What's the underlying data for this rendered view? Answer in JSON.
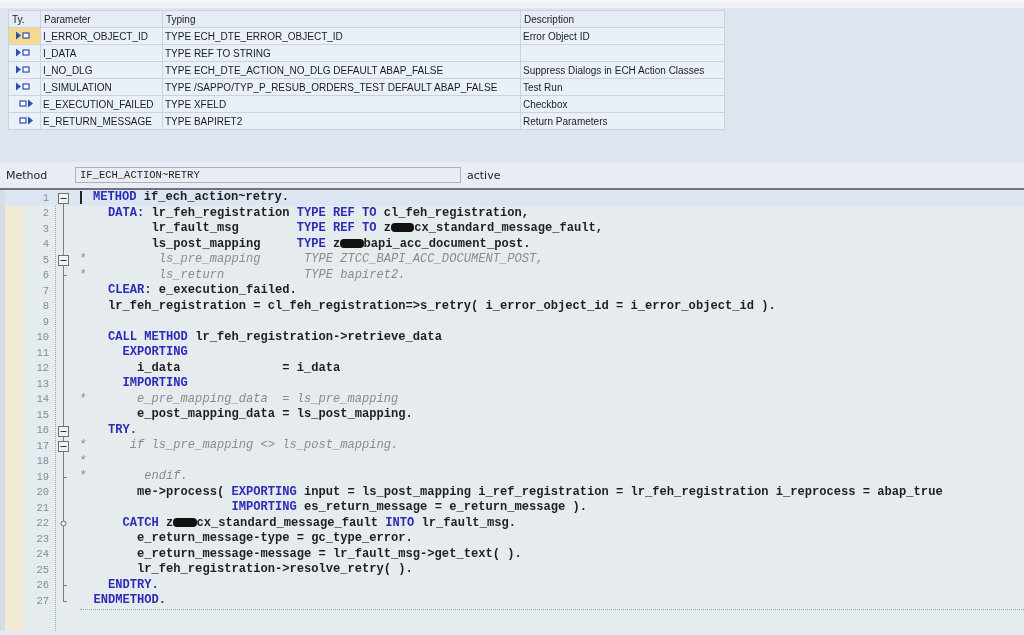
{
  "parameters": {
    "columns": [
      "Ty.",
      "Parameter",
      "Typing",
      "Description"
    ],
    "rows": [
      {
        "kind": "importing",
        "selected": true,
        "name": "I_ERROR_OBJECT_ID",
        "typing": "TYPE ECH_DTE_ERROR_OBJECT_ID",
        "description": "Error Object ID"
      },
      {
        "kind": "importing",
        "selected": false,
        "name": "I_DATA",
        "typing": "TYPE REF TO STRING"
      },
      {
        "kind": "importing",
        "selected": false,
        "name": "I_NO_DLG",
        "typing": "TYPE ECH_DTE_ACTION_NO_DLG  DEFAULT ABAP_FALSE",
        "description": "Suppress Dialogs in ECH Action Classes"
      },
      {
        "kind": "importing",
        "selected": false,
        "name": "I_SIMULATION",
        "typing": "TYPE /SAPPO/TYP_P_RESUB_ORDERS_TEST  DEFAULT ABAP_FALSE",
        "description": "Test Run"
      },
      {
        "kind": "exporting",
        "selected": false,
        "name": "E_EXECUTION_FAILED",
        "typing": "TYPE XFELD",
        "description": "Checkbox"
      },
      {
        "kind": "exporting",
        "selected": false,
        "name": "E_RETURN_MESSAGE",
        "typing": "TYPE BAPIRET2",
        "description": "Return Parameters"
      }
    ]
  },
  "method": {
    "label": "Method",
    "value": "IF_ECH_ACTION~RETRY",
    "status": "active"
  },
  "editor": {
    "lines": [
      {
        "number": "1",
        "kind": "collapse",
        "selected": true,
        "tokens": [
          {
            "kind": "keyword",
            "text": "METHOD"
          },
          {
            "kind": "plain",
            "text": " if_ech_action~retry."
          }
        ]
      },
      {
        "number": "2",
        "kind": "line",
        "selected": false,
        "tokens": [
          {
            "kind": "keyword",
            "text": "    DATA:"
          },
          {
            "kind": "plain",
            "text": " lr_feh_registration "
          },
          {
            "kind": "keyword",
            "text": "TYPE REF TO"
          },
          {
            "kind": "plain",
            "text": " cl_feh_registration,"
          }
        ]
      },
      {
        "number": "3",
        "kind": "line",
        "selected": false,
        "tokens": [
          {
            "kind": "plain",
            "text": "          lr_fault_msg        "
          },
          {
            "kind": "keyword",
            "text": "TYPE REF TO"
          },
          {
            "kind": "plain",
            "text": " z"
          },
          {
            "kind": "redacted"
          },
          {
            "kind": "plain",
            "text": "cx_standard_message_fault,"
          }
        ]
      },
      {
        "number": "4",
        "kind": "line",
        "selected": false,
        "tokens": [
          {
            "kind": "plain",
            "text": "          ls_post_mapping     "
          },
          {
            "kind": "keyword",
            "text": "TYPE"
          },
          {
            "kind": "plain",
            "text": " z"
          },
          {
            "kind": "redacted"
          },
          {
            "kind": "plain",
            "text": "bapi_acc_document_post."
          }
        ]
      },
      {
        "number": "5",
        "kind": "collapse",
        "selected": false,
        "tokens": [
          {
            "kind": "comment",
            "text": "*          ls_pre_mapping      TYPE ZTCC_BAPI_ACC_DOCUMENT_POST,"
          }
        ]
      },
      {
        "number": "6",
        "kind": "end",
        "selected": false,
        "tokens": [
          {
            "kind": "comment",
            "text": "*          ls_return           TYPE bapiret2."
          }
        ]
      },
      {
        "number": "7",
        "kind": "line",
        "selected": false,
        "tokens": [
          {
            "kind": "keyword",
            "text": "    CLEAR:"
          },
          {
            "kind": "plain",
            "text": " e_execution_failed."
          }
        ]
      },
      {
        "number": "8",
        "kind": "line",
        "selected": false,
        "tokens": [
          {
            "kind": "plain",
            "text": "    lr_feh_registration = cl_feh_registration=>s_retry( i_error_object_id = i_error_object_id )."
          }
        ]
      },
      {
        "number": "9",
        "kind": "line",
        "selected": false
      },
      {
        "number": "10",
        "kind": "line",
        "selected": false,
        "tokens": [
          {
            "kind": "keyword",
            "text": "    CALL METHOD"
          },
          {
            "kind": "plain",
            "text": " lr_feh_registration->retrieve_data"
          }
        ]
      },
      {
        "number": "11",
        "kind": "line",
        "selected": false,
        "tokens": [
          {
            "kind": "keyword",
            "text": "      EXPORTING"
          }
        ]
      },
      {
        "number": "12",
        "kind": "line",
        "selected": false,
        "tokens": [
          {
            "kind": "plain",
            "text": "        i_data              = i_data"
          }
        ]
      },
      {
        "number": "13",
        "kind": "line",
        "selected": false,
        "tokens": [
          {
            "kind": "keyword",
            "text": "      IMPORTING"
          }
        ]
      },
      {
        "number": "14",
        "kind": "line",
        "selected": false,
        "tokens": [
          {
            "kind": "comment",
            "text": "*       e_pre_mapping_data  = ls_pre_mapping"
          }
        ]
      },
      {
        "number": "15",
        "kind": "line",
        "selected": false,
        "tokens": [
          {
            "kind": "plain",
            "text": "        e_post_mapping_data = ls_post_mapping."
          }
        ]
      },
      {
        "number": "16",
        "kind": "collapse",
        "selected": false,
        "tokens": [
          {
            "kind": "keyword",
            "text": "    TRY."
          }
        ]
      },
      {
        "number": "17",
        "kind": "collapse",
        "selected": false,
        "tokens": [
          {
            "kind": "comment",
            "text": "*      if ls_pre_mapping <> ls_post_mapping."
          }
        ]
      },
      {
        "number": "18",
        "kind": "line",
        "selected": false,
        "tokens": [
          {
            "kind": "comment",
            "text": "*"
          }
        ]
      },
      {
        "number": "19",
        "kind": "end",
        "selected": false,
        "tokens": [
          {
            "kind": "comment",
            "text": "*        endif."
          }
        ]
      },
      {
        "number": "20",
        "kind": "line",
        "selected": false,
        "tokens": [
          {
            "kind": "plain",
            "text": "        me->process( "
          },
          {
            "kind": "keyword",
            "text": "EXPORTING"
          },
          {
            "kind": "plain",
            "text": " input = ls_post_mapping i_ref_registration = lr_feh_registration i_reprocess = abap_true"
          }
        ]
      },
      {
        "number": "21",
        "kind": "line",
        "selected": false,
        "tokens": [
          {
            "kind": "keyword",
            "text": "                     IMPORTING"
          },
          {
            "kind": "plain",
            "text": " es_return_message = e_return_message )."
          }
        ]
      },
      {
        "number": "22",
        "kind": "node",
        "selected": false,
        "tokens": [
          {
            "kind": "keyword",
            "text": "      CATCH"
          },
          {
            "kind": "plain",
            "text": " z"
          },
          {
            "kind": "redacted"
          },
          {
            "kind": "plain",
            "text": "cx_standard_message_fault "
          },
          {
            "kind": "keyword",
            "text": "INTO"
          },
          {
            "kind": "plain",
            "text": " lr_fault_msg."
          }
        ]
      },
      {
        "number": "23",
        "kind": "line",
        "selected": false,
        "tokens": [
          {
            "kind": "plain",
            "text": "        e_return_message-type = gc_type_error."
          }
        ]
      },
      {
        "number": "24",
        "kind": "line",
        "selected": false,
        "tokens": [
          {
            "kind": "plain",
            "text": "        e_return_message-message = lr_fault_msg->get_text( )."
          }
        ]
      },
      {
        "number": "25",
        "kind": "line",
        "selected": false,
        "tokens": [
          {
            "kind": "plain",
            "text": "        lr_feh_registration->resolve_retry( )."
          }
        ]
      },
      {
        "number": "26",
        "kind": "end",
        "selected": false,
        "tokens": [
          {
            "kind": "keyword",
            "text": "    ENDTRY."
          }
        ]
      },
      {
        "number": "27",
        "kind": "last",
        "selected": false,
        "tokens": [
          {
            "kind": "keyword",
            "text": "  ENDMETHOD."
          }
        ]
      }
    ]
  }
}
